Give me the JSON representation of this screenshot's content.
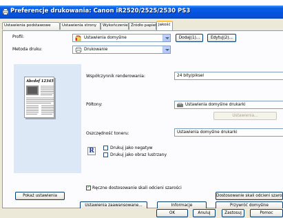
{
  "window": {
    "title": "Preferencje drukowania: Canon iR2520/2525/2530 PS3"
  },
  "tabs": [
    {
      "label": "Ustawienia podstawowe",
      "active": false
    },
    {
      "label": "Ustawienia strony",
      "active": false
    },
    {
      "label": "Wykończenie",
      "active": false
    },
    {
      "label": "Źródło papieru",
      "active": false
    },
    {
      "label": "Jakość",
      "active": true
    }
  ],
  "profile": {
    "label": "Profil:",
    "value": "Ustawienia domyślne",
    "add_button": "Dodaj(1)...",
    "edit_button": "Edytuj(2)..."
  },
  "print_method": {
    "label": "Metoda druku:",
    "value": "Drukowanie"
  },
  "preview": {
    "page_heading": "Abcdef 12345",
    "show_settings_button": "Pokaż ustawienia"
  },
  "rendering": {
    "label": "Współczynnik renderowania:",
    "value": "24 bity/piksel"
  },
  "halftones": {
    "label": "Półtony:",
    "value": "Ustawienia domyślne drukarki",
    "settings_button": "Ustawienia..."
  },
  "toner_save": {
    "label": "Oszczędność toneru:",
    "value": "Ustawienia domyślne drukarki"
  },
  "print_options": {
    "negative_label": "Drukuj jako negatyw",
    "negative_checked": false,
    "mirror_label": "Drukuj jako obraz lustrzany",
    "mirror_checked": false,
    "manual_gray_label": "Ręczne dostosowanie skali odcieni szarości",
    "manual_gray_checked": true,
    "gray_adjust_button": "Dostosowanie skali odcieni szarości..."
  },
  "footer_buttons": {
    "advanced": "Ustawienia zaawansowane...",
    "info": "Informacje",
    "restore": "Przywróć domyślne"
  },
  "dialog_buttons": {
    "ok": "OK",
    "cancel": "Anuluj",
    "apply": "Zastosuj",
    "help": "Pomoc"
  }
}
